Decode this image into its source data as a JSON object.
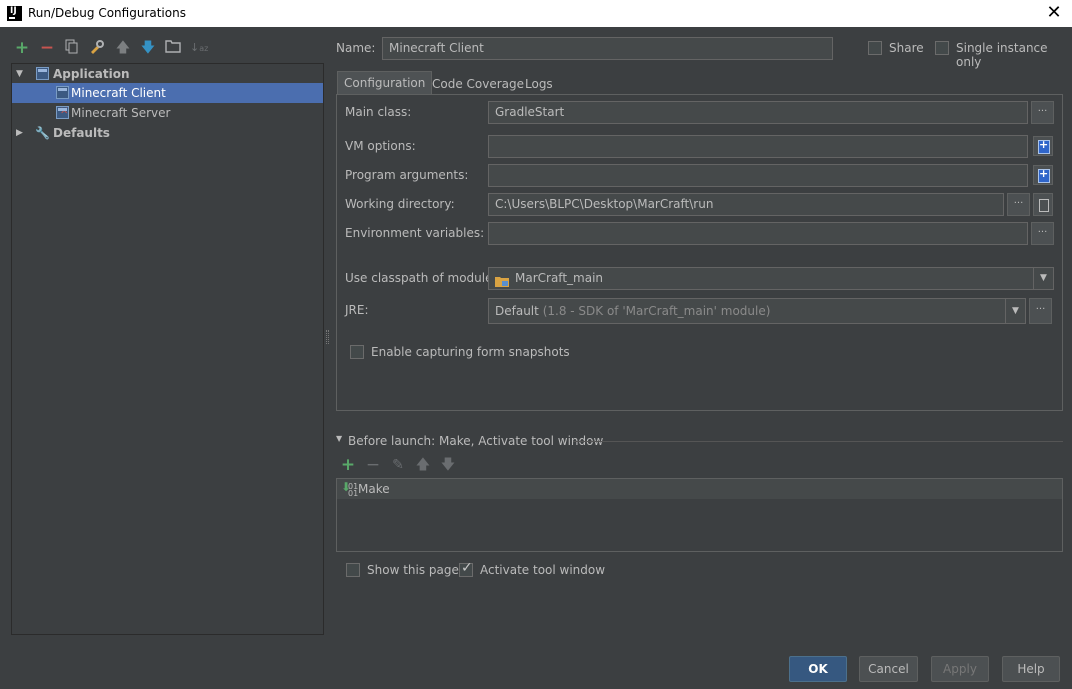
{
  "window": {
    "title": "Run/Debug Configurations",
    "app_icon_text": "IJ"
  },
  "tree": {
    "items": [
      {
        "label": "Application",
        "level": 0,
        "expanded": true,
        "selected": false
      },
      {
        "label": "Minecraft Client",
        "level": 1,
        "selected": true
      },
      {
        "label": "Minecraft Server",
        "level": 1,
        "selected": false
      },
      {
        "label": "Defaults",
        "level": 0,
        "expanded": false,
        "selected": false
      }
    ]
  },
  "name_row": {
    "label": "Name:",
    "value": "Minecraft Client",
    "share_label": "Share",
    "single_instance_label": "Single instance only"
  },
  "tabs": [
    {
      "label": "Configuration",
      "active": true
    },
    {
      "label": "Code Coverage",
      "active": false
    },
    {
      "label": "Logs",
      "active": false
    }
  ],
  "form": {
    "main_class": {
      "label": "Main class:",
      "value": "GradleStart"
    },
    "vm_options": {
      "label": "VM options:",
      "value": ""
    },
    "program_args": {
      "label": "Program arguments:",
      "value": ""
    },
    "working_dir": {
      "label": "Working directory:",
      "value": "C:\\Users\\BLPC\\Desktop\\MarCraft\\run"
    },
    "env_vars": {
      "label": "Environment variables:",
      "value": ""
    },
    "classpath_module": {
      "label": "Use classpath of module:",
      "value": "MarCraft_main"
    },
    "jre": {
      "label": "JRE:",
      "value": "Default",
      "detail": "(1.8 - SDK of 'MarCraft_main' module)"
    },
    "snapshots": {
      "label": "Enable capturing form snapshots",
      "checked": false
    }
  },
  "before_launch": {
    "title": "Before launch: Make, Activate tool window",
    "items": [
      {
        "label": "Make"
      }
    ]
  },
  "options": {
    "show_page": {
      "label": "Show this page",
      "checked": false
    },
    "activate_tool": {
      "label": "Activate tool window",
      "checked": true
    }
  },
  "buttons": {
    "ok": "OK",
    "cancel": "Cancel",
    "apply": "Apply",
    "help": "Help"
  },
  "colors": {
    "background": "#3c3f41",
    "selection": "#4b6eaf",
    "add_green": "#59a869",
    "remove_red": "#c75450",
    "primary_button": "#365880"
  },
  "toolbar_icons": [
    "add-icon",
    "remove-icon",
    "copy-icon",
    "edit-defaults-icon",
    "move-up-icon",
    "move-down-icon",
    "folder-icon",
    "sort-icon"
  ]
}
